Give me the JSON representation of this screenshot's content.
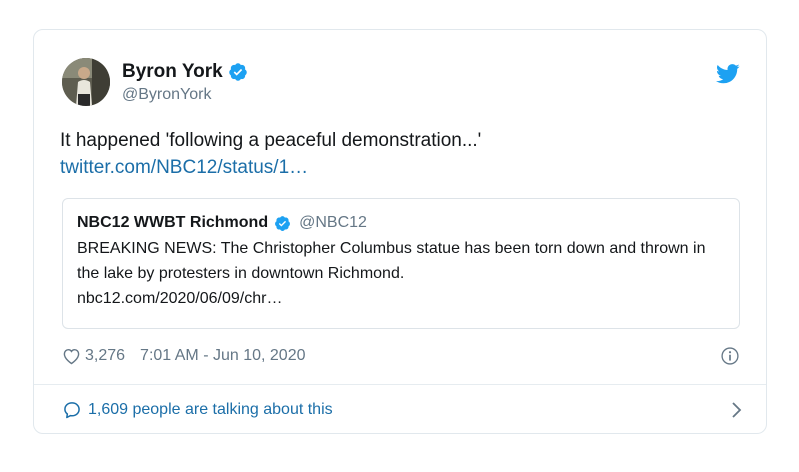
{
  "tweet": {
    "author": {
      "name": "Byron York",
      "handle": "@ByronYork",
      "avatar_icon": "user-avatar"
    },
    "text": "It happened 'following a peaceful demonstration...'",
    "link_text": "twitter.com/NBC12/status/1…",
    "quoted": {
      "name": "NBC12 WWBT Richmond",
      "handle": "@NBC12",
      "text": "BREAKING NEWS: The Christopher Columbus statue has been torn down and thrown in the lake by protesters in downtown Richmond.",
      "link_text": "nbc12.com/2020/06/09/chr…"
    },
    "likes": "3,276",
    "timestamp": "7:01 AM - Jun 10, 2020",
    "talking_text": "1,609 people are talking about this"
  },
  "icons": {
    "verified": "verified-badge-icon",
    "twitter": "twitter-bird-icon",
    "like": "heart-icon",
    "info": "info-icon",
    "reply": "speech-bubble-icon",
    "chevron": "chevron-right-icon"
  },
  "colors": {
    "accent": "#1da1f2",
    "link": "#1b6ea8",
    "secondary_text": "#657786",
    "border": "#e1e8ed"
  }
}
